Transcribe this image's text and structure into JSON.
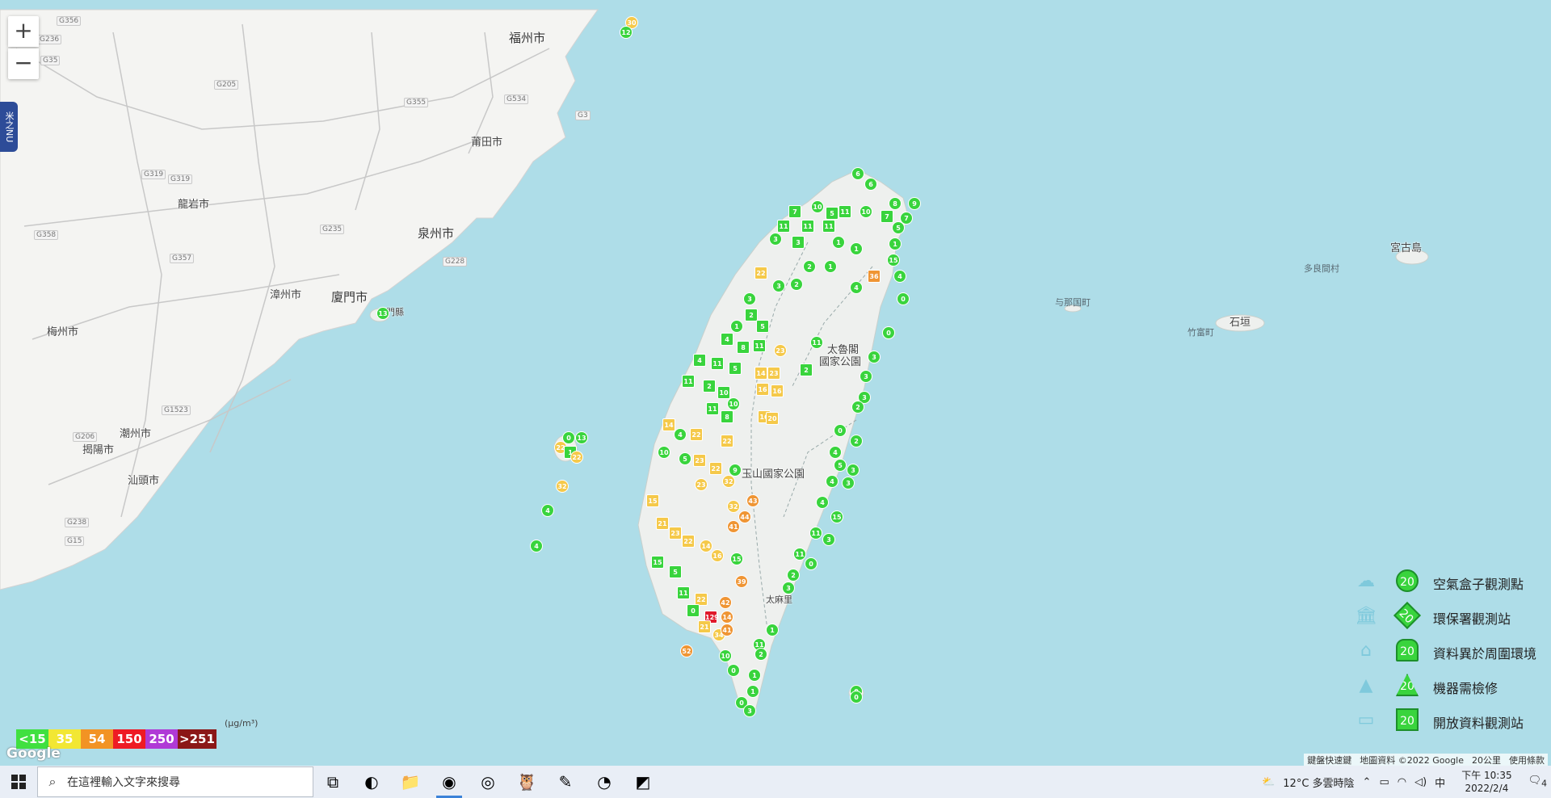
{
  "map": {
    "zoom_in": "+",
    "zoom_out": "−",
    "side_tab": "米之NU",
    "places": [
      {
        "id": "fuzhou",
        "label": "福州市",
        "major": true
      },
      {
        "id": "putian",
        "label": "莆田市",
        "major": false
      },
      {
        "id": "quanzhou",
        "label": "泉州市",
        "major": true
      },
      {
        "id": "longyan",
        "label": "龍岩市",
        "major": false
      },
      {
        "id": "zhangzhou",
        "label": "漳州市",
        "major": false
      },
      {
        "id": "xiamen",
        "label": "廈門市",
        "major": true
      },
      {
        "id": "meizhou",
        "label": "梅州市",
        "major": false
      },
      {
        "id": "chaozhou",
        "label": "潮州市",
        "major": false
      },
      {
        "id": "jieyang",
        "label": "揭陽市",
        "major": false
      },
      {
        "id": "shantou",
        "label": "汕頭市",
        "major": false
      },
      {
        "id": "miyako",
        "label": "宮古島",
        "major": false
      },
      {
        "id": "tarama",
        "label": "多良間村",
        "major": false
      },
      {
        "id": "yonaguni",
        "label": "与那国町",
        "major": false
      },
      {
        "id": "taketomi",
        "label": "竹富町",
        "major": false
      },
      {
        "id": "ishigaki",
        "label": "石垣",
        "major": false
      },
      {
        "id": "taroko",
        "label": "太魯閣",
        "major": false
      },
      {
        "id": "taroko2",
        "label": "國家公園",
        "major": false
      },
      {
        "id": "yushan",
        "label": "玉山國家公園",
        "major": false
      },
      {
        "id": "taimali",
        "label": "太麻里",
        "major": false
      },
      {
        "id": "kinmen",
        "label": "門縣",
        "major": false
      }
    ],
    "roads": [
      "G356",
      "G236",
      "G35",
      "G205",
      "G319",
      "G355",
      "G534",
      "G3",
      "G358",
      "G235",
      "G15",
      "G1523",
      "G206",
      "G238",
      "G228",
      "G357",
      "G319"
    ],
    "markers": [
      {
        "v": "30",
        "c": "y"
      },
      {
        "v": "12",
        "c": "g"
      },
      {
        "v": "13",
        "c": "g"
      },
      {
        "v": "6",
        "c": "g"
      },
      {
        "v": "9",
        "c": "g"
      },
      {
        "v": "7",
        "c": "g"
      },
      {
        "v": "10",
        "c": "g"
      },
      {
        "v": "8",
        "c": "g"
      },
      {
        "v": "11",
        "c": "g"
      },
      {
        "v": "5",
        "c": "g"
      },
      {
        "v": "4",
        "c": "g"
      },
      {
        "v": "3",
        "c": "g"
      },
      {
        "v": "2",
        "c": "g"
      },
      {
        "v": "1",
        "c": "g"
      },
      {
        "v": "0",
        "c": "g"
      },
      {
        "v": "15",
        "c": "g"
      },
      {
        "v": "36",
        "c": "o"
      },
      {
        "v": "22",
        "c": "y"
      },
      {
        "v": "23",
        "c": "y"
      },
      {
        "v": "14",
        "c": "g"
      },
      {
        "v": "21",
        "c": "y"
      },
      {
        "v": "32",
        "c": "y"
      },
      {
        "v": "43",
        "c": "o"
      },
      {
        "v": "44",
        "c": "o"
      },
      {
        "v": "41",
        "c": "o"
      },
      {
        "v": "39",
        "c": "o"
      },
      {
        "v": "42",
        "c": "o"
      },
      {
        "v": "129",
        "c": "r"
      },
      {
        "v": "52",
        "c": "o"
      },
      {
        "v": "34",
        "c": "y"
      },
      {
        "v": "16",
        "c": "y"
      },
      {
        "v": "20",
        "c": "y"
      }
    ]
  },
  "legend_scale": {
    "unit": "(μg/m³)",
    "items": [
      {
        "label": "<15",
        "color": "#40e040"
      },
      {
        "label": "35",
        "color": "#f2e733"
      },
      {
        "label": "54",
        "color": "#f29324"
      },
      {
        "label": "150",
        "color": "#ee1b24"
      },
      {
        "label": "250",
        "color": "#b03ad6"
      },
      {
        "label": ">251",
        "color": "#8b1717"
      }
    ]
  },
  "legend_types": [
    {
      "icon": "air-box-icon",
      "value": "20",
      "label": "空氣盒子觀測點",
      "shape": "circle"
    },
    {
      "icon": "government-building-icon",
      "value": "20",
      "label": "環保署觀測站",
      "shape": "diamond"
    },
    {
      "icon": "house-icon",
      "value": "20",
      "label": "資料異於周圍環境",
      "shape": "house"
    },
    {
      "icon": "cone-icon",
      "value": "20",
      "label": "機器需檢修",
      "shape": "triangle"
    },
    {
      "icon": "open-data-icon",
      "value": "20",
      "label": "開放資料觀測站",
      "shape": "square"
    }
  ],
  "attribution": {
    "logo": "Google",
    "shortcuts": "鍵盤快速鍵",
    "map_data": "地圖資料 ©2022 Google",
    "scale": "20公里",
    "terms": "使用條款"
  },
  "taskbar": {
    "search_placeholder": "在這裡輸入文字來搜尋",
    "weather": "12°C 多雲時陰",
    "ime": "中",
    "time": "下午 10:35",
    "date": "2022/2/4",
    "notifications": "4",
    "apps": [
      "task-view-icon",
      "edge-icon",
      "file-explorer-icon",
      "chrome-icon",
      "compass-app-icon",
      "owl-app-icon",
      "draw-app-icon",
      "blender-icon",
      "cube-app-icon"
    ],
    "active_app": "chrome-icon"
  }
}
